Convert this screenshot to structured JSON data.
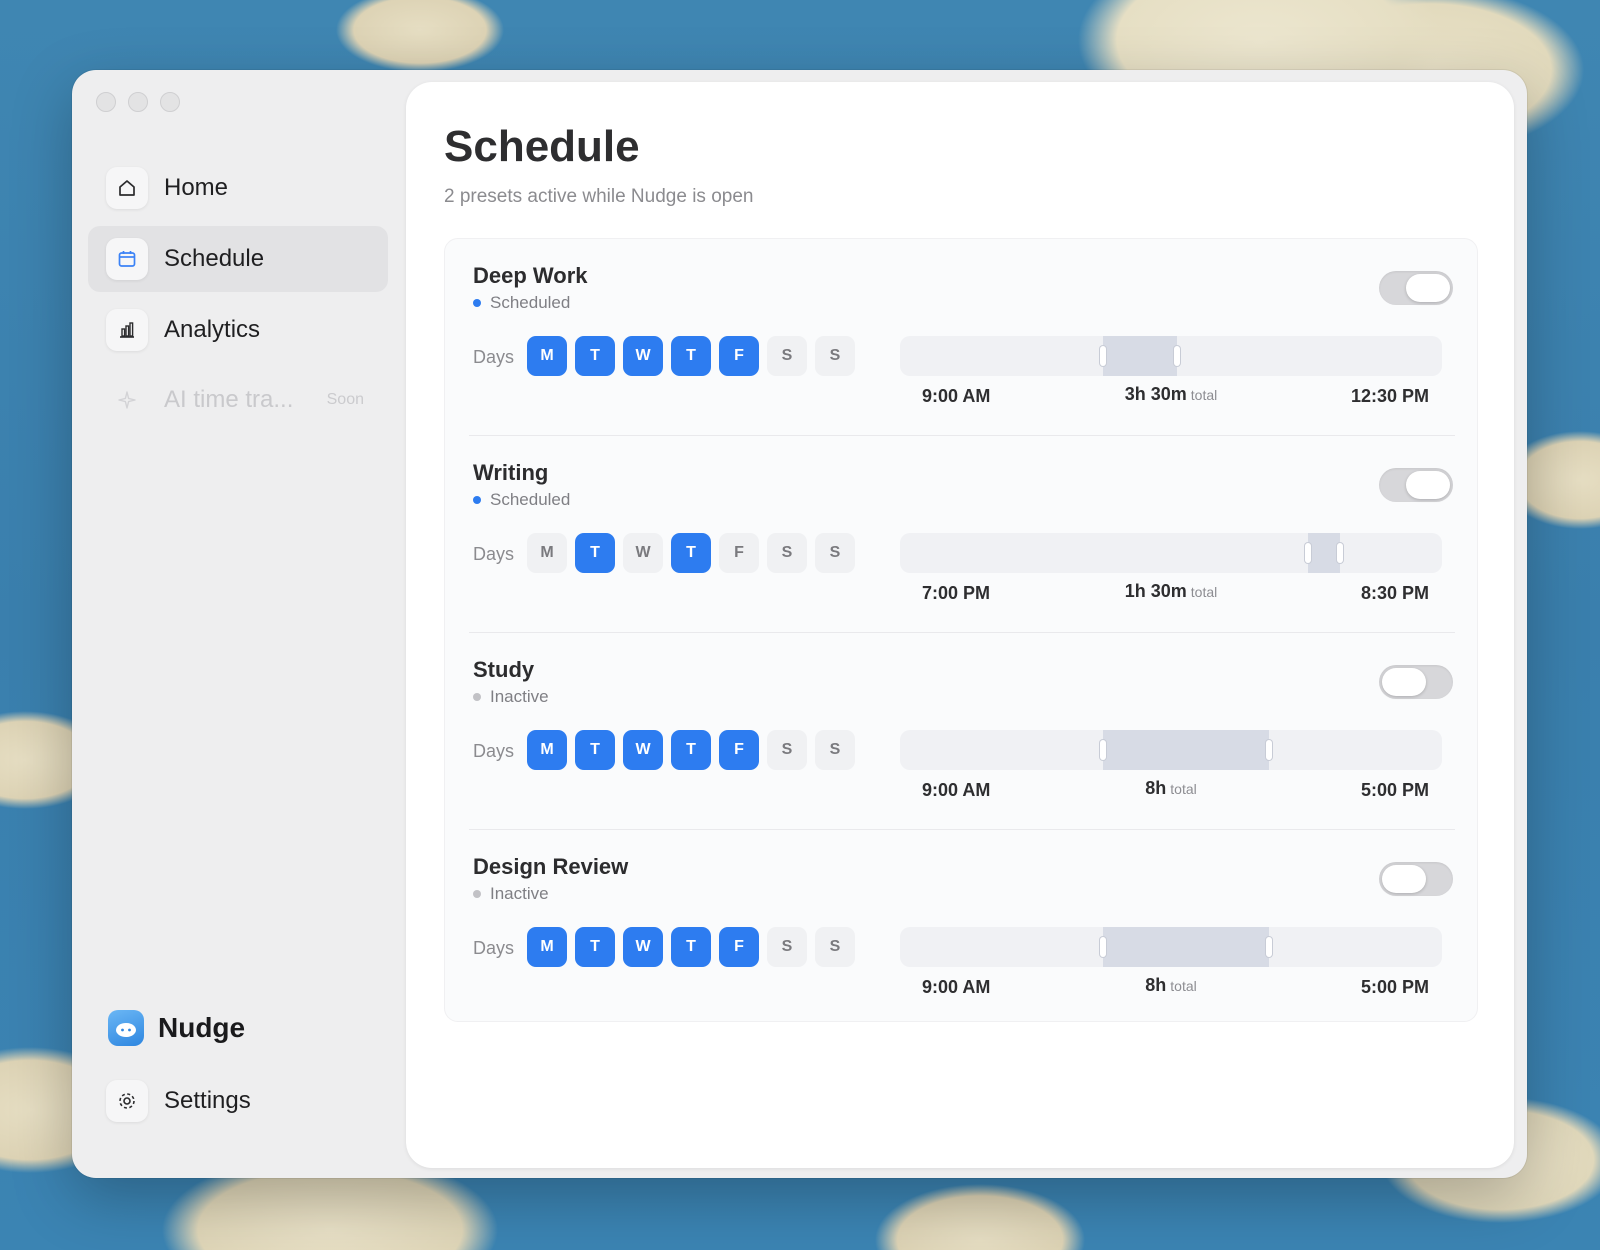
{
  "sidebar": {
    "items": [
      {
        "label": "Home",
        "icon": "house-icon"
      },
      {
        "label": "Schedule",
        "icon": "calendar-icon"
      },
      {
        "label": "Analytics",
        "icon": "bar-chart-icon"
      },
      {
        "label": "AI time tra...",
        "badge": "Soon",
        "icon": "sparkle-icon"
      }
    ],
    "brand": "Nudge",
    "settings_label": "Settings"
  },
  "page": {
    "title": "Schedule",
    "subtitle": "2 presets active while Nudge is open"
  },
  "colors": {
    "accent": "#2d7cf0",
    "scheduled_dot": "#2d7cf0",
    "inactive_dot": "#c2c2c6"
  },
  "presets": [
    {
      "name": "Deep Work",
      "status": "Scheduled",
      "enabled": true,
      "days": [
        {
          "l": "M",
          "on": true
        },
        {
          "l": "T",
          "on": true
        },
        {
          "l": "W",
          "on": true
        },
        {
          "l": "T",
          "on": true
        },
        {
          "l": "F",
          "on": true
        },
        {
          "l": "S",
          "on": false
        },
        {
          "l": "S",
          "on": false
        }
      ],
      "start": "9:00 AM",
      "end": "12:30 PM",
      "total": "3h 30m",
      "total_suffix": "total"
    },
    {
      "name": "Writing",
      "status": "Scheduled",
      "enabled": true,
      "days": [
        {
          "l": "M",
          "on": false
        },
        {
          "l": "T",
          "on": true
        },
        {
          "l": "W",
          "on": false
        },
        {
          "l": "T",
          "on": true
        },
        {
          "l": "F",
          "on": false
        },
        {
          "l": "S",
          "on": false
        },
        {
          "l": "S",
          "on": false
        }
      ],
      "start": "7:00 PM",
      "end": "8:30 PM",
      "total": "1h 30m",
      "total_suffix": "total"
    },
    {
      "name": "Study",
      "status": "Inactive",
      "enabled": false,
      "days": [
        {
          "l": "M",
          "on": true
        },
        {
          "l": "T",
          "on": true
        },
        {
          "l": "W",
          "on": true
        },
        {
          "l": "T",
          "on": true
        },
        {
          "l": "F",
          "on": true
        },
        {
          "l": "S",
          "on": false
        },
        {
          "l": "S",
          "on": false
        }
      ],
      "start": "9:00 AM",
      "end": "5:00 PM",
      "total": "8h",
      "total_suffix": "total"
    },
    {
      "name": "Design Review",
      "status": "Inactive",
      "enabled": false,
      "days": [
        {
          "l": "M",
          "on": true
        },
        {
          "l": "T",
          "on": true
        },
        {
          "l": "W",
          "on": true
        },
        {
          "l": "T",
          "on": true
        },
        {
          "l": "F",
          "on": true
        },
        {
          "l": "S",
          "on": false
        },
        {
          "l": "S",
          "on": false
        }
      ],
      "start": "9:00 AM",
      "end": "5:00 PM",
      "total": "8h",
      "total_suffix": "total"
    }
  ],
  "days_label": "Days"
}
